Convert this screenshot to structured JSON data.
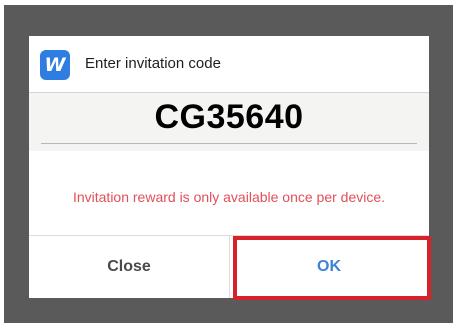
{
  "dialog": {
    "app_icon": {
      "name": "w-app-icon",
      "glyph": "W",
      "color": "#2f7de1"
    },
    "title": "Enter invitation code",
    "code_value": "CG35640",
    "message": "Invitation reward is only available once per device.",
    "buttons": {
      "close_label": "Close",
      "ok_label": "OK"
    }
  },
  "colors": {
    "message": "#e0505a",
    "ok": "#3d82d6",
    "highlight": "#d7212b"
  }
}
